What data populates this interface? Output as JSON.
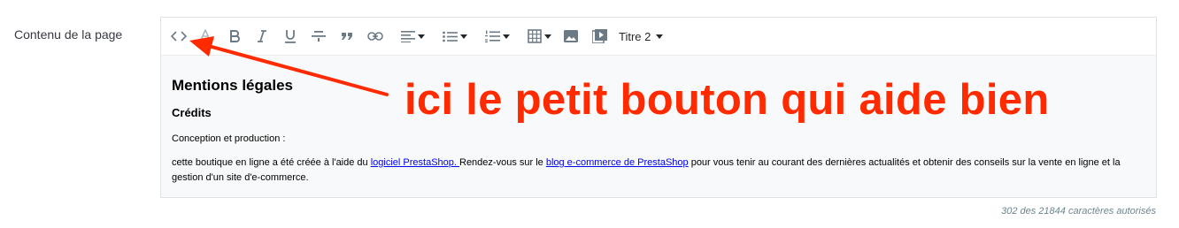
{
  "field": {
    "label": "Contenu de la page"
  },
  "toolbar": {
    "icons": [
      "source-code-icon",
      "text-color-icon",
      "bold-icon",
      "italic-icon",
      "underline-icon",
      "strikethrough-icon",
      "blockquote-icon",
      "link-icon",
      "align-left-icon",
      "bullet-list-icon",
      "numbered-list-icon",
      "table-icon",
      "image-icon",
      "media-icon"
    ],
    "format_label": "Titre 2"
  },
  "content": {
    "heading": "Mentions légales",
    "subheading": "Crédits",
    "p1": "Conception et production :",
    "p2_before": "cette boutique en ligne a été créée à l'aide du ",
    "p2_link1": "logiciel PrestaShop. ",
    "p2_middle": "Rendez-vous sur le ",
    "p2_link2": "blog e-commerce de PrestaShop",
    "p2_after": " pour vous tenir au courant des dernières actualités et obtenir des conseils sur la vente en ligne et la gestion d'un site d'e-commerce."
  },
  "counter": "302 des 21844 caractères autorisés",
  "annotation": {
    "text": "ici le petit bouton qui aide bien",
    "color": "#ff2a00"
  }
}
